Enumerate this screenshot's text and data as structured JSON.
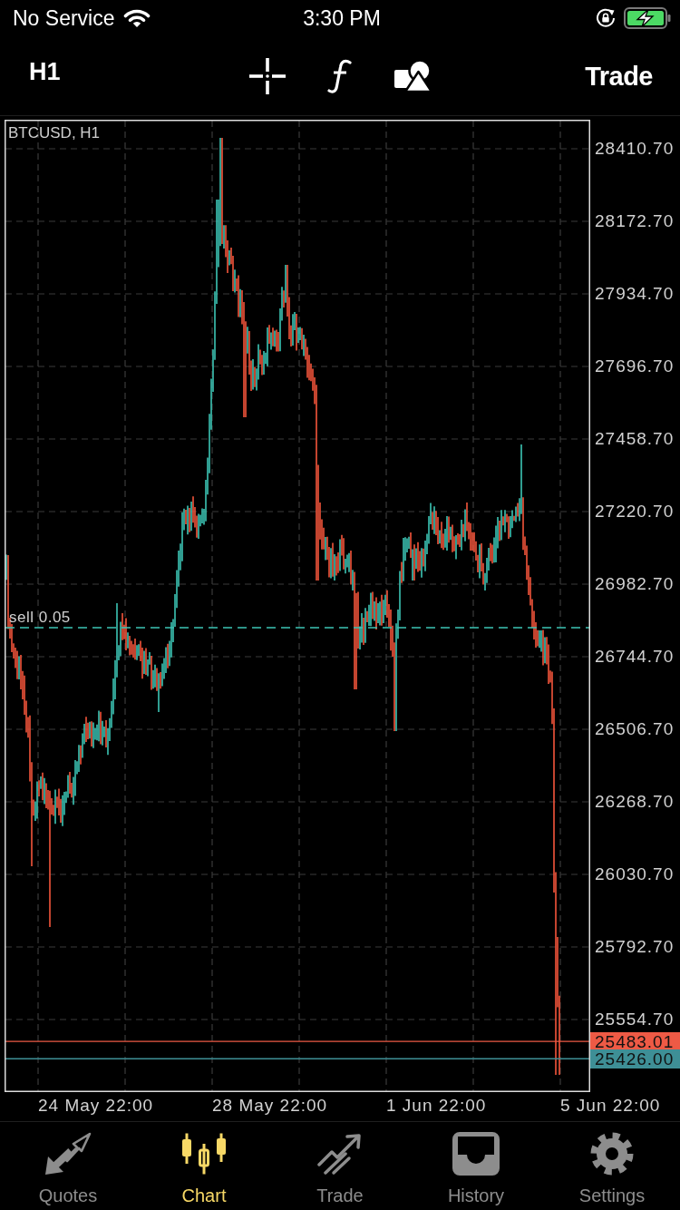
{
  "status_bar": {
    "carrier": "No Service",
    "time": "3:30 PM"
  },
  "toolbar": {
    "timeframe": "H1",
    "trade": "Trade"
  },
  "chart": {
    "title": "BTCUSD, H1",
    "order_label": "sell 0.05",
    "y_axis_labels": [
      "28410.70",
      "28172.70",
      "27934.70",
      "27696.70",
      "27458.70",
      "27220.70",
      "26982.70",
      "26744.70",
      "26506.70",
      "26268.70",
      "26030.70",
      "25792.70",
      "25554.70"
    ],
    "price_tags": [
      {
        "text": "25483.01",
        "color": "#ee5a45"
      },
      {
        "text": "25426.00",
        "color": "#3e8f96"
      }
    ],
    "x_axis_labels": [
      "24 May 22:00",
      "28 May 22:00",
      "1 Jun 22:00",
      "5 Jun 22:00"
    ]
  },
  "tabs": [
    {
      "label": "Quotes",
      "selected": false
    },
    {
      "label": "Chart",
      "selected": true
    },
    {
      "label": "Trade",
      "selected": false
    },
    {
      "label": "History",
      "selected": false
    },
    {
      "label": "Settings",
      "selected": false
    }
  ]
}
